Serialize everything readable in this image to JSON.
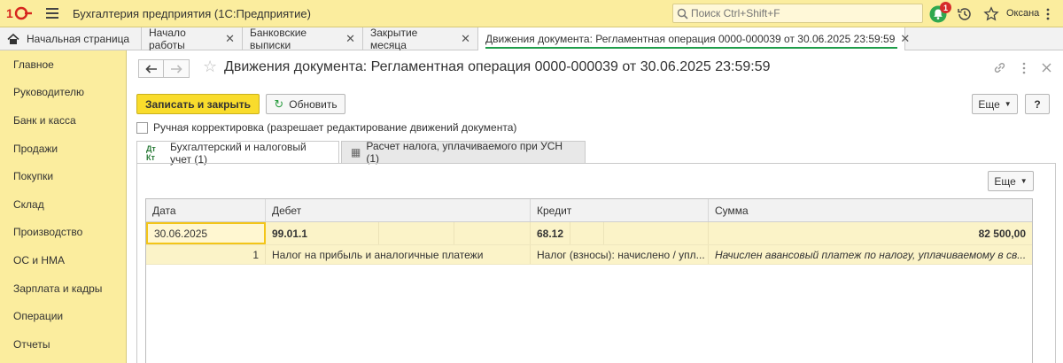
{
  "titlebar": {
    "app_title": "Бухгалтерия предприятия  (1С:Предприятие)",
    "search_placeholder": "Поиск Ctrl+Shift+F",
    "notification_count": "1",
    "user_name": "Оксана"
  },
  "tabs": [
    {
      "label": "Начальная страница",
      "icon": "home-icon"
    },
    {
      "label": "Начало работы"
    },
    {
      "label": "Банковские выписки"
    },
    {
      "label": "Закрытие месяца"
    },
    {
      "label": "Движения документа: Регламентная операция 0000-000039 от 30.06.2025 23:59:59",
      "active": true
    }
  ],
  "sidebar": {
    "items": [
      {
        "label": "Главное"
      },
      {
        "label": "Руководителю"
      },
      {
        "label": "Банк и касса"
      },
      {
        "label": "Продажи"
      },
      {
        "label": "Покупки"
      },
      {
        "label": "Склад"
      },
      {
        "label": "Производство"
      },
      {
        "label": "ОС и НМА"
      },
      {
        "label": "Зарплата и кадры"
      },
      {
        "label": "Операции"
      },
      {
        "label": "Отчеты"
      }
    ]
  },
  "document": {
    "title": "Движения документа: Регламентная операция 0000-000039 от 30.06.2025 23:59:59",
    "save_close_label": "Записать и закрыть",
    "refresh_label": "Обновить",
    "more_label": "Еще",
    "help_label": "?",
    "manual_correction_label": "Ручная корректировка (разрешает редактирование движений документа)",
    "subtabs": [
      {
        "label": "Бухгалтерский и налоговый учет (1)",
        "icon_text": "Дт Кт"
      },
      {
        "label": "Расчет налога, уплачиваемого при УСН (1)"
      }
    ],
    "panel_more_label": "Еще"
  },
  "grid": {
    "headers": {
      "date": "Дата",
      "debit": "Дебет",
      "credit": "Кредит",
      "sum": "Сумма"
    },
    "row": {
      "date": "30.06.2025",
      "debit_account": "99.01.1",
      "credit_account": "68.12",
      "sum": "82 500,00",
      "number": "1",
      "debit_subconto": "Налог на прибыль и аналогичные платежи",
      "credit_subconto": "Налог (взносы): начислено / упл...",
      "content": "Начислен авансовый платеж по налогу, уплачиваемому в св..."
    }
  },
  "colors": {
    "accent_yellow": "#fbed9e",
    "primary_button": "#f9dc2c",
    "active_tab_underline": "#1f9d4a",
    "row_highlight": "#fbf3c8"
  }
}
